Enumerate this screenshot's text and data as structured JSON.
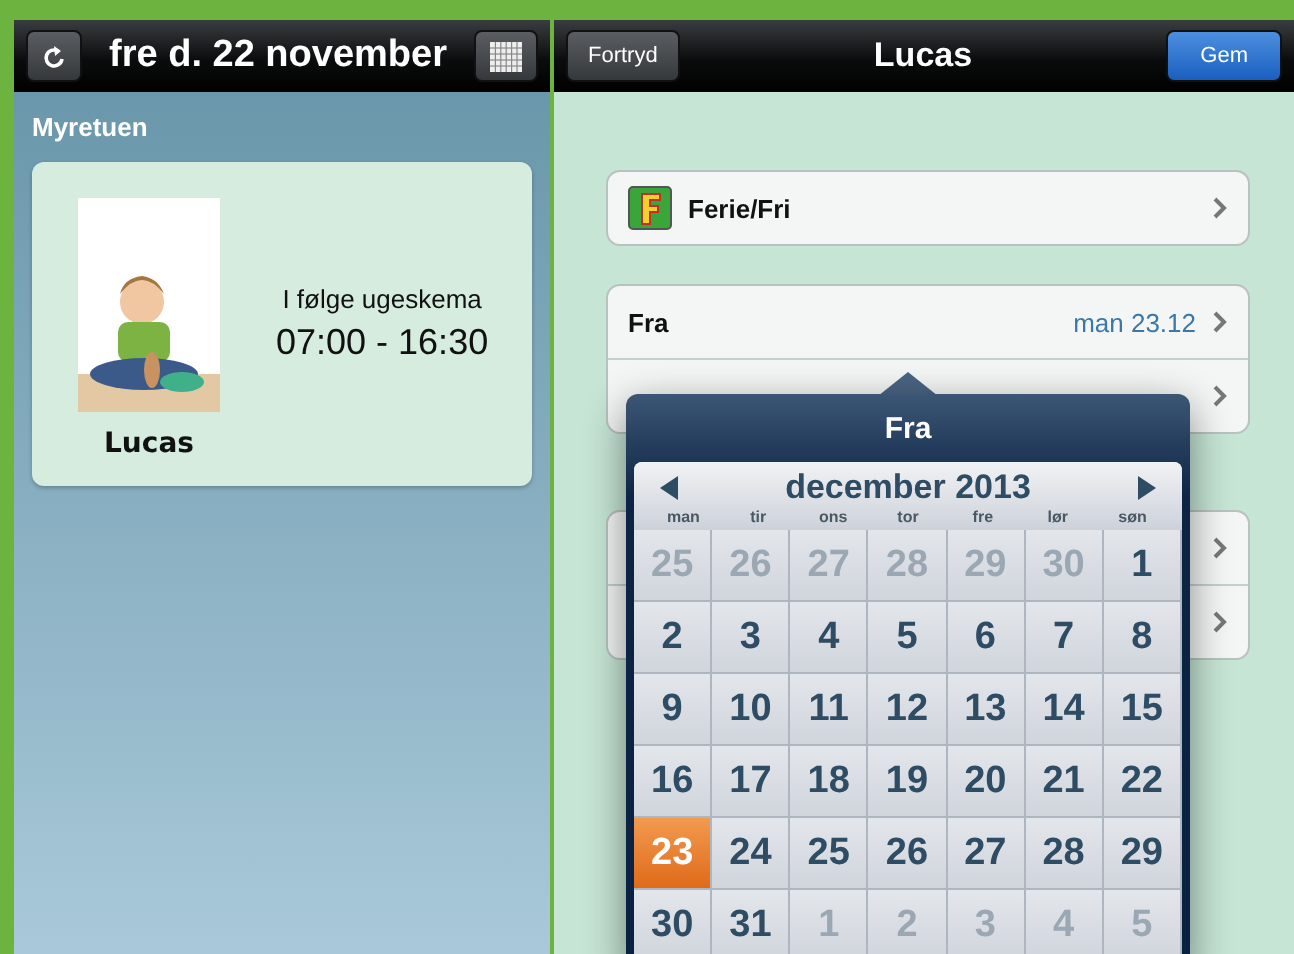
{
  "left_toolbar": {
    "title": "fre d. 22 november"
  },
  "right_toolbar": {
    "cancel": "Fortryd",
    "title": "Lucas",
    "save": "Gem"
  },
  "left_panel": {
    "group": "Myretuen",
    "card": {
      "name": "Lucas",
      "schedule": "I følge ugeskema",
      "time": "07:00 - 16:30"
    }
  },
  "form": {
    "type_row": {
      "label": "Ferie/Fri"
    },
    "from_row": {
      "label": "Fra",
      "value": "man 23.12"
    }
  },
  "popover": {
    "title": "Fra",
    "month": "december 2013",
    "weekdays": [
      "man",
      "tir",
      "ons",
      "tor",
      "fre",
      "lør",
      "søn"
    ],
    "days": [
      {
        "label": "25",
        "outside": true,
        "selected": false
      },
      {
        "label": "26",
        "outside": true,
        "selected": false
      },
      {
        "label": "27",
        "outside": true,
        "selected": false
      },
      {
        "label": "28",
        "outside": true,
        "selected": false
      },
      {
        "label": "29",
        "outside": true,
        "selected": false
      },
      {
        "label": "30",
        "outside": true,
        "selected": false
      },
      {
        "label": "1",
        "outside": false,
        "selected": false
      },
      {
        "label": "2",
        "outside": false,
        "selected": false
      },
      {
        "label": "3",
        "outside": false,
        "selected": false
      },
      {
        "label": "4",
        "outside": false,
        "selected": false
      },
      {
        "label": "5",
        "outside": false,
        "selected": false
      },
      {
        "label": "6",
        "outside": false,
        "selected": false
      },
      {
        "label": "7",
        "outside": false,
        "selected": false
      },
      {
        "label": "8",
        "outside": false,
        "selected": false
      },
      {
        "label": "9",
        "outside": false,
        "selected": false
      },
      {
        "label": "10",
        "outside": false,
        "selected": false
      },
      {
        "label": "11",
        "outside": false,
        "selected": false
      },
      {
        "label": "12",
        "outside": false,
        "selected": false
      },
      {
        "label": "13",
        "outside": false,
        "selected": false
      },
      {
        "label": "14",
        "outside": false,
        "selected": false
      },
      {
        "label": "15",
        "outside": false,
        "selected": false
      },
      {
        "label": "16",
        "outside": false,
        "selected": false
      },
      {
        "label": "17",
        "outside": false,
        "selected": false
      },
      {
        "label": "18",
        "outside": false,
        "selected": false
      },
      {
        "label": "19",
        "outside": false,
        "selected": false
      },
      {
        "label": "20",
        "outside": false,
        "selected": false
      },
      {
        "label": "21",
        "outside": false,
        "selected": false
      },
      {
        "label": "22",
        "outside": false,
        "selected": false
      },
      {
        "label": "23",
        "outside": false,
        "selected": true
      },
      {
        "label": "24",
        "outside": false,
        "selected": false
      },
      {
        "label": "25",
        "outside": false,
        "selected": false
      },
      {
        "label": "26",
        "outside": false,
        "selected": false
      },
      {
        "label": "27",
        "outside": false,
        "selected": false
      },
      {
        "label": "28",
        "outside": false,
        "selected": false
      },
      {
        "label": "29",
        "outside": false,
        "selected": false
      },
      {
        "label": "30",
        "outside": false,
        "selected": false
      },
      {
        "label": "31",
        "outside": false,
        "selected": false
      },
      {
        "label": "1",
        "outside": true,
        "selected": false
      },
      {
        "label": "2",
        "outside": true,
        "selected": false
      },
      {
        "label": "3",
        "outside": true,
        "selected": false
      },
      {
        "label": "4",
        "outside": true,
        "selected": false
      },
      {
        "label": "5",
        "outside": true,
        "selected": false
      }
    ]
  }
}
